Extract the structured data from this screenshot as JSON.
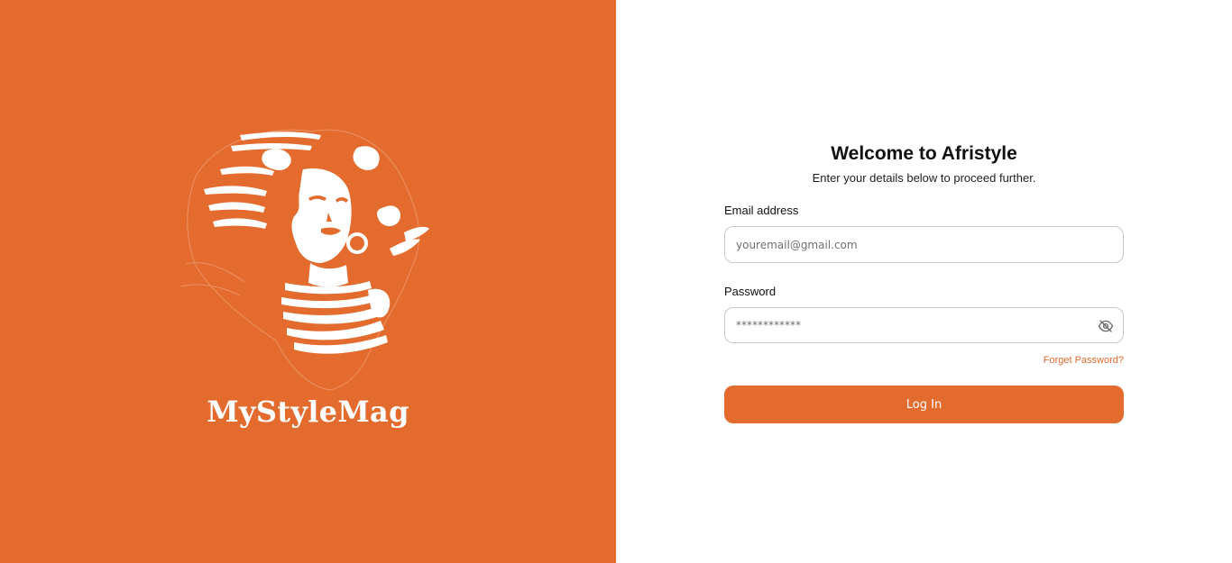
{
  "brand": {
    "name": "MyStyleMag",
    "panel_color": "#E36B2D",
    "logo_icon": "woman-portrait-logo-icon"
  },
  "login": {
    "title": "Welcome to Afristyle",
    "subtitle": "Enter your details below to proceed further.",
    "email_label": "Email address",
    "email_placeholder": "youremail@gmail.com",
    "email_value": "",
    "password_label": "Password",
    "password_placeholder": "************",
    "password_value": "",
    "password_toggle_icon": "eye-off-icon",
    "forgot_password": "Forget Password?",
    "submit_label": "Log In"
  },
  "colors": {
    "accent": "#E36B2D",
    "text": "#111111",
    "border": "#c8c8c8"
  }
}
